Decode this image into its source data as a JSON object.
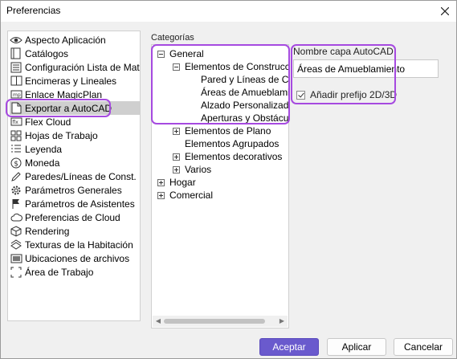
{
  "window": {
    "title": "Preferencias"
  },
  "sidebar": {
    "items": [
      {
        "label": "Aspecto Aplicación",
        "icon": "eye-icon"
      },
      {
        "label": "Catálogos",
        "icon": "catalog-icon"
      },
      {
        "label": "Configuración Lista de Materiales",
        "icon": "list-icon"
      },
      {
        "label": "Encimeras y Lineales",
        "icon": "countertop-icon"
      },
      {
        "label": "Enlace MagicPlan",
        "icon": "magicplan-icon"
      },
      {
        "label": "Exportar a AutoCAD",
        "icon": "export-file-icon"
      },
      {
        "label": "Flex Cloud",
        "icon": "flex-cloud-icon"
      },
      {
        "label": "Hojas de Trabajo",
        "icon": "worksheet-icon"
      },
      {
        "label": "Leyenda",
        "icon": "legend-icon"
      },
      {
        "label": "Moneda",
        "icon": "currency-icon"
      },
      {
        "label": "Paredes/Líneas de Const.",
        "icon": "pencil-icon"
      },
      {
        "label": "Parámetros Generales",
        "icon": "gear-icon"
      },
      {
        "label": "Parámetros de Asistentes",
        "icon": "flag-icon"
      },
      {
        "label": "Preferencias de Cloud",
        "icon": "cloud-icon"
      },
      {
        "label": "Rendering",
        "icon": "cube-icon"
      },
      {
        "label": "Texturas de la Habitación",
        "icon": "texture-icon"
      },
      {
        "label": "Ubicaciones de archivos",
        "icon": "folder-icon"
      },
      {
        "label": "Área de Trabajo",
        "icon": "workspace-icon"
      }
    ],
    "selected_index": 5
  },
  "categories": {
    "label": "Categorías",
    "tree": [
      {
        "label": "General",
        "level": 0,
        "expander": "minus"
      },
      {
        "label": "Elementos de Construcción",
        "level": 1,
        "expander": "minus"
      },
      {
        "label": "Pared y Líneas de Construcción",
        "level": 2,
        "expander": "none"
      },
      {
        "label": "Áreas de Amueblamiento",
        "level": 2,
        "expander": "none"
      },
      {
        "label": "Alzado Personalizado",
        "level": 2,
        "expander": "none"
      },
      {
        "label": "Aperturas y Obstáculos",
        "level": 2,
        "expander": "none"
      },
      {
        "label": "Elementos de Plano",
        "level": 1,
        "expander": "plus"
      },
      {
        "label": "Elementos Agrupados",
        "level": 1,
        "expander": "none"
      },
      {
        "label": "Elementos decorativos",
        "level": 1,
        "expander": "plus"
      },
      {
        "label": "Varios",
        "level": 1,
        "expander": "plus"
      },
      {
        "label": "Hogar",
        "level": 0,
        "expander": "plus"
      },
      {
        "label": "Comercial",
        "level": 0,
        "expander": "plus"
      }
    ]
  },
  "details": {
    "layer_name_label": "Nombre capa AutoCAD",
    "layer_name_value": "Áreas de Amueblamiento",
    "prefix_checkbox_label": "Añadir prefijo 2D/3D",
    "prefix_checked": true
  },
  "buttons": {
    "accept": "Aceptar",
    "apply": "Aplicar",
    "cancel": "Cancelar"
  },
  "colors": {
    "highlight": "#a64ae0",
    "primary_button": "#6a5acd",
    "selection": "#cfcfcf"
  }
}
